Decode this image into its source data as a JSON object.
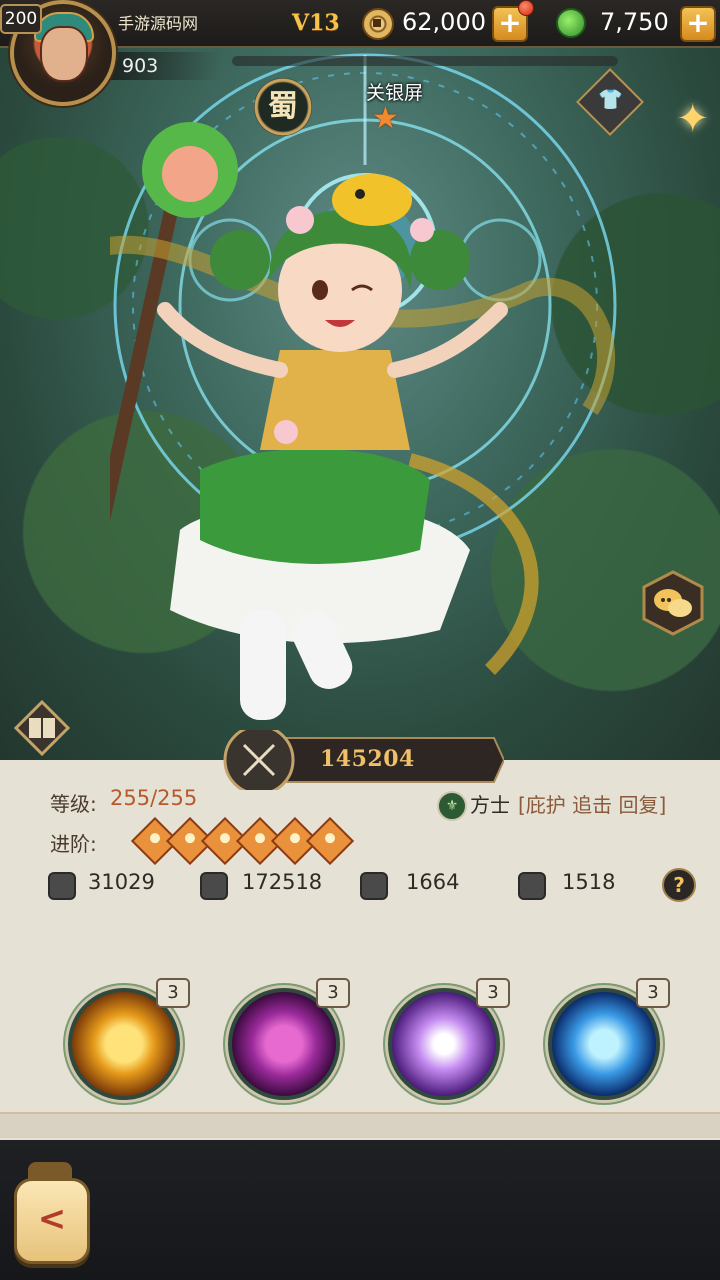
{
  "player": {
    "level": "200",
    "name": "手游源码网",
    "power": "903",
    "vip": "V13"
  },
  "currencies": {
    "coins": "62,000",
    "potions": "7,750"
  },
  "hero": {
    "faction": "蜀",
    "name": "关银屏",
    "stars": 1,
    "combat_power": "145204",
    "level_label": "等级:",
    "level_value": "255/255",
    "advance_label": "进阶:",
    "advance_gems": 6,
    "class_name": "方士",
    "class_tags": "[庇护 追击 回复]",
    "stats": [
      {
        "icon": "attack-icon",
        "value": "31029"
      },
      {
        "icon": "health-icon",
        "value": "172518"
      },
      {
        "icon": "defense-icon",
        "value": "1664"
      },
      {
        "icon": "speed-icon",
        "value": "1518"
      }
    ],
    "skills": [
      {
        "icon": "golden-armor-skill-icon",
        "level": "3"
      },
      {
        "icon": "shadow-strike-skill-icon",
        "level": "3"
      },
      {
        "icon": "burst-skill-icon",
        "level": "3"
      },
      {
        "icon": "dash-skill-icon",
        "level": "3"
      }
    ]
  },
  "colors": {
    "accent": "#f2c35b",
    "panel": "#e6e1d5",
    "level_text": "#b55a2a",
    "gem": "#e9913b"
  }
}
